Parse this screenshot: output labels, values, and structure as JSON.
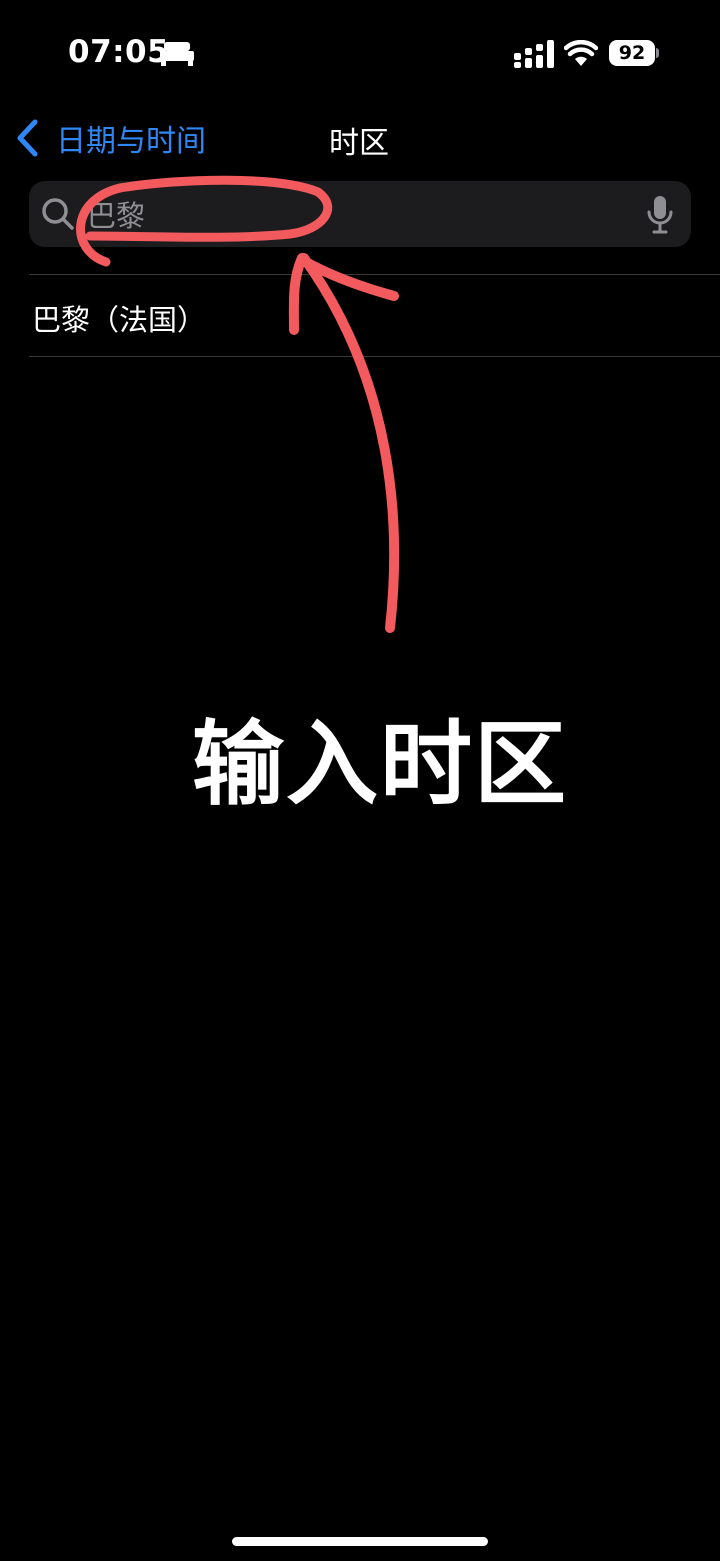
{
  "status_bar": {
    "time": "07:05",
    "battery_level": "92",
    "icons": [
      "bed-icon",
      "signal-icon",
      "wifi-icon",
      "battery-icon"
    ]
  },
  "nav": {
    "back_label": "日期与时间",
    "title": "时区",
    "back_icon": "chevron-left-icon"
  },
  "search": {
    "value": "巴黎",
    "icons": [
      "search-icon",
      "mic-icon"
    ]
  },
  "results": [
    {
      "label": "巴黎（法国）"
    }
  ],
  "annotation": {
    "text": "输入时区",
    "color": "#f25a5e"
  },
  "colors": {
    "accent": "#2f87f5",
    "background": "#000000",
    "search_field": "#1c1c1e",
    "annotation": "#f25a5e"
  }
}
